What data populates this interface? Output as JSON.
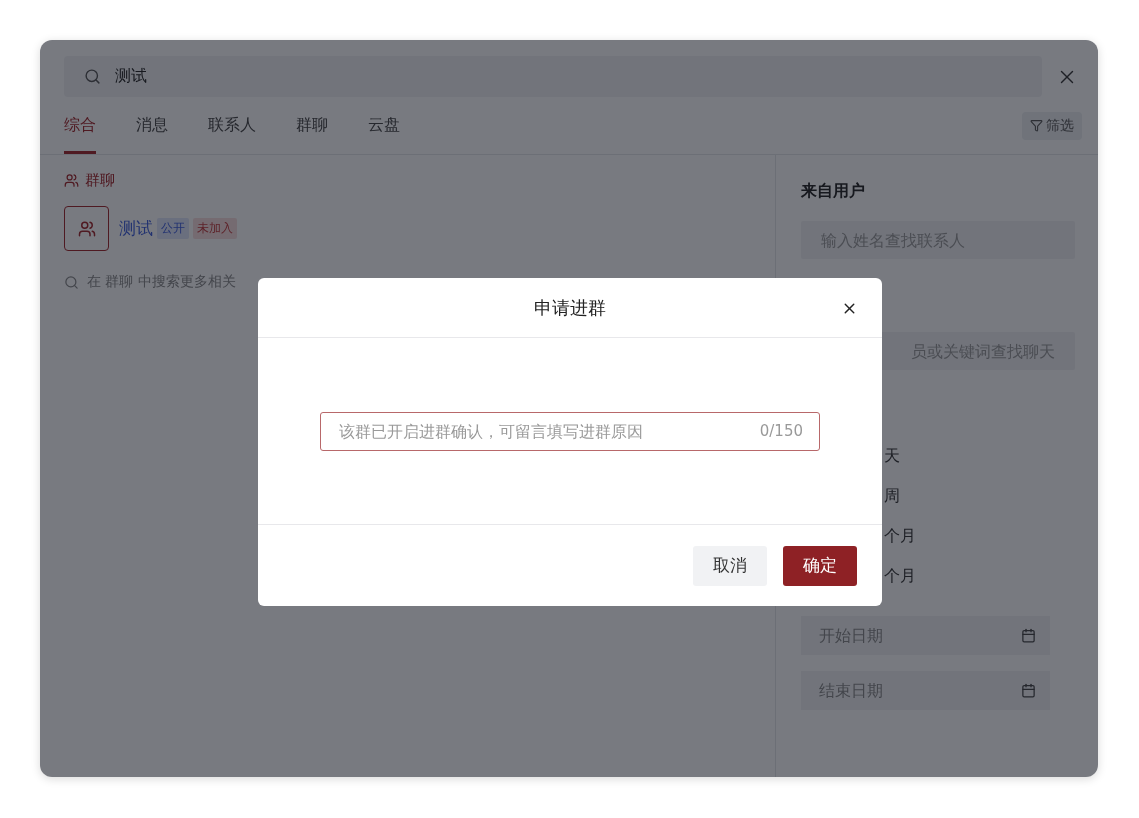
{
  "search": {
    "value": "测试"
  },
  "tabs": [
    {
      "label": "综合",
      "selected": true
    },
    {
      "label": "消息",
      "selected": false
    },
    {
      "label": "联系人",
      "selected": false
    },
    {
      "label": "群聊",
      "selected": false
    },
    {
      "label": "云盘",
      "selected": false
    }
  ],
  "filter_button": {
    "label": "筛选"
  },
  "results": {
    "section_title": "群聊",
    "groups": [
      {
        "name": "测试",
        "tags": [
          {
            "label": "公开",
            "kind": "public"
          },
          {
            "label": "未加入",
            "kind": "unjoined"
          }
        ]
      }
    ],
    "search_more": "在 群聊 中搜索更多相关"
  },
  "filters": {
    "from_user": {
      "label": "来自用户",
      "placeholder": "输入姓名查找联系人"
    },
    "chat_search": {
      "placeholder": "员或关键词查找聊天"
    },
    "time_options": [
      {
        "label": "天"
      },
      {
        "label": "周"
      },
      {
        "label": "个月"
      },
      {
        "label": "个月"
      }
    ],
    "start_date": {
      "placeholder": "开始日期"
    },
    "end_date": {
      "placeholder": "结束日期"
    }
  },
  "dialog": {
    "title": "申请进群",
    "reason": {
      "placeholder": "该群已开启进群确认，可留言填写进群原因",
      "counter": "0/150"
    },
    "buttons": [
      {
        "label": "取消",
        "kind": "secondary"
      },
      {
        "label": "确定",
        "kind": "primary"
      }
    ]
  }
}
